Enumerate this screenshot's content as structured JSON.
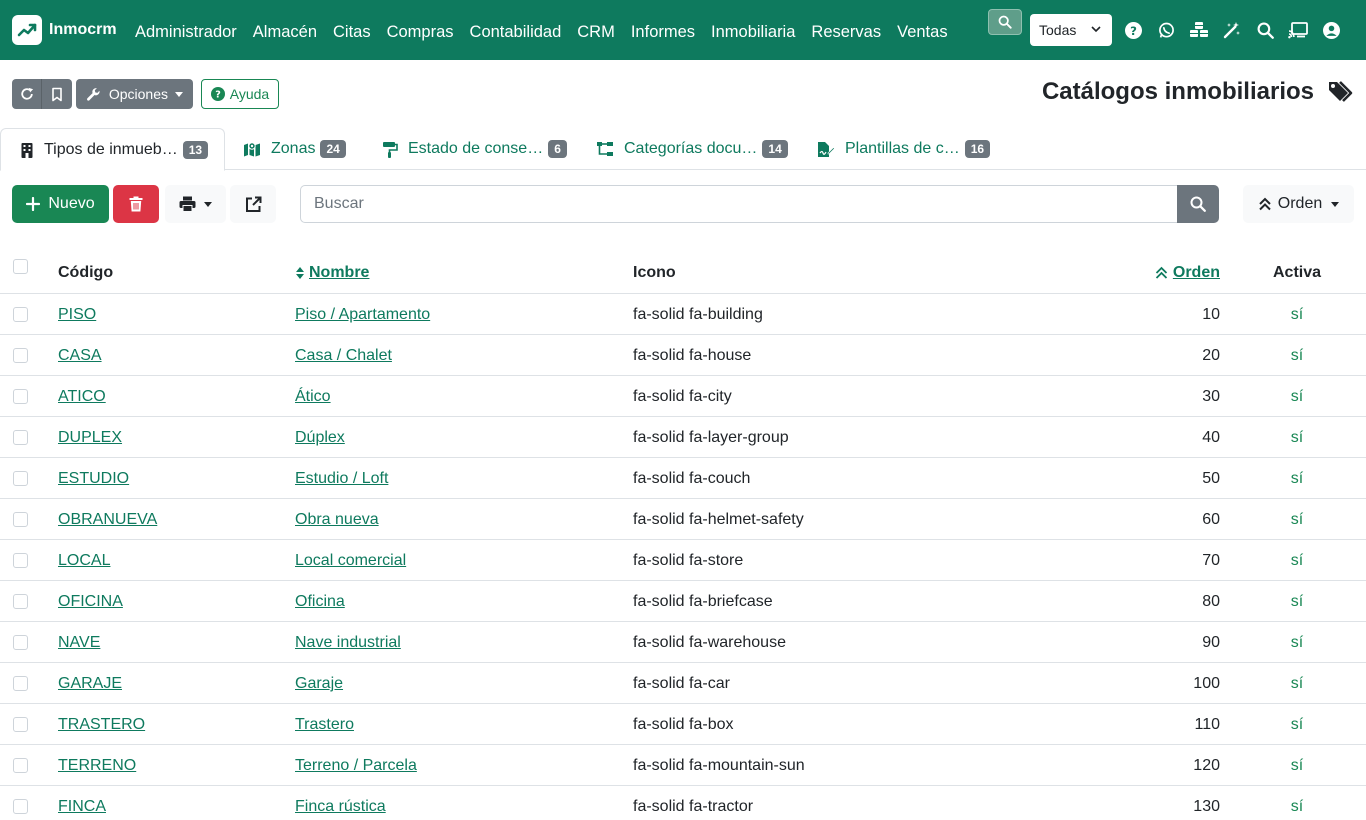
{
  "app": {
    "brand": "Inmocrm",
    "colors": {
      "primary": "#0e7a5e",
      "success": "#198754",
      "danger": "#dc3545",
      "secondary": "#6c757d"
    }
  },
  "nav": {
    "menu": [
      "Administrador",
      "Almacén",
      "Citas",
      "Compras",
      "Contabilidad",
      "CRM",
      "Informes",
      "Inmobiliaria",
      "Reservas",
      "Ventas"
    ],
    "company_select": "Todas",
    "icons": [
      "help-icon",
      "whatsapp-icon",
      "cubes-icon",
      "magic-wand-icon",
      "search-icon",
      "cast-icon",
      "user-icon"
    ]
  },
  "toolbar": {
    "options_label": "Opciones",
    "help_label": "Ayuda"
  },
  "page": {
    "title": "Catálogos inmobiliarios"
  },
  "tabs": [
    {
      "label": "Tipos de inmueb…",
      "count": "13",
      "icon": "building-icon"
    },
    {
      "label": "Zonas",
      "count": "24",
      "icon": "map-icon"
    },
    {
      "label": "Estado de conse…",
      "count": "6",
      "icon": "paint-roller-icon"
    },
    {
      "label": "Categorías docu…",
      "count": "14",
      "icon": "sitemap-icon"
    },
    {
      "label": "Plantillas de c…",
      "count": "16",
      "icon": "file-signature-icon"
    }
  ],
  "actions": {
    "new_label": "Nuevo",
    "search_placeholder": "Buscar",
    "order_label": "Orden"
  },
  "table": {
    "headers": {
      "codigo": "Código",
      "nombre": "Nombre",
      "icono": "Icono",
      "orden": "Orden",
      "activa": "Activa"
    },
    "rows": [
      {
        "codigo": "PISO",
        "nombre": "Piso / Apartamento",
        "icono": "fa-solid fa-building",
        "orden": "10",
        "activa": "sí"
      },
      {
        "codigo": "CASA",
        "nombre": "Casa / Chalet",
        "icono": "fa-solid fa-house",
        "orden": "20",
        "activa": "sí"
      },
      {
        "codigo": "ATICO",
        "nombre": "Ático",
        "icono": "fa-solid fa-city",
        "orden": "30",
        "activa": "sí"
      },
      {
        "codigo": "DUPLEX",
        "nombre": "Dúplex",
        "icono": "fa-solid fa-layer-group",
        "orden": "40",
        "activa": "sí"
      },
      {
        "codigo": "ESTUDIO",
        "nombre": "Estudio / Loft",
        "icono": "fa-solid fa-couch",
        "orden": "50",
        "activa": "sí"
      },
      {
        "codigo": "OBRANUEVA",
        "nombre": "Obra nueva",
        "icono": "fa-solid fa-helmet-safety",
        "orden": "60",
        "activa": "sí"
      },
      {
        "codigo": "LOCAL",
        "nombre": "Local comercial",
        "icono": "fa-solid fa-store",
        "orden": "70",
        "activa": "sí"
      },
      {
        "codigo": "OFICINA",
        "nombre": "Oficina",
        "icono": "fa-solid fa-briefcase",
        "orden": "80",
        "activa": "sí"
      },
      {
        "codigo": "NAVE",
        "nombre": "Nave industrial",
        "icono": "fa-solid fa-warehouse",
        "orden": "90",
        "activa": "sí"
      },
      {
        "codigo": "GARAJE",
        "nombre": "Garaje",
        "icono": "fa-solid fa-car",
        "orden": "100",
        "activa": "sí"
      },
      {
        "codigo": "TRASTERO",
        "nombre": "Trastero",
        "icono": "fa-solid fa-box",
        "orden": "110",
        "activa": "sí"
      },
      {
        "codigo": "TERRENO",
        "nombre": "Terreno / Parcela",
        "icono": "fa-solid fa-mountain-sun",
        "orden": "120",
        "activa": "sí"
      },
      {
        "codigo": "FINCA",
        "nombre": "Finca rústica",
        "icono": "fa-solid fa-tractor",
        "orden": "130",
        "activa": "sí"
      }
    ]
  }
}
